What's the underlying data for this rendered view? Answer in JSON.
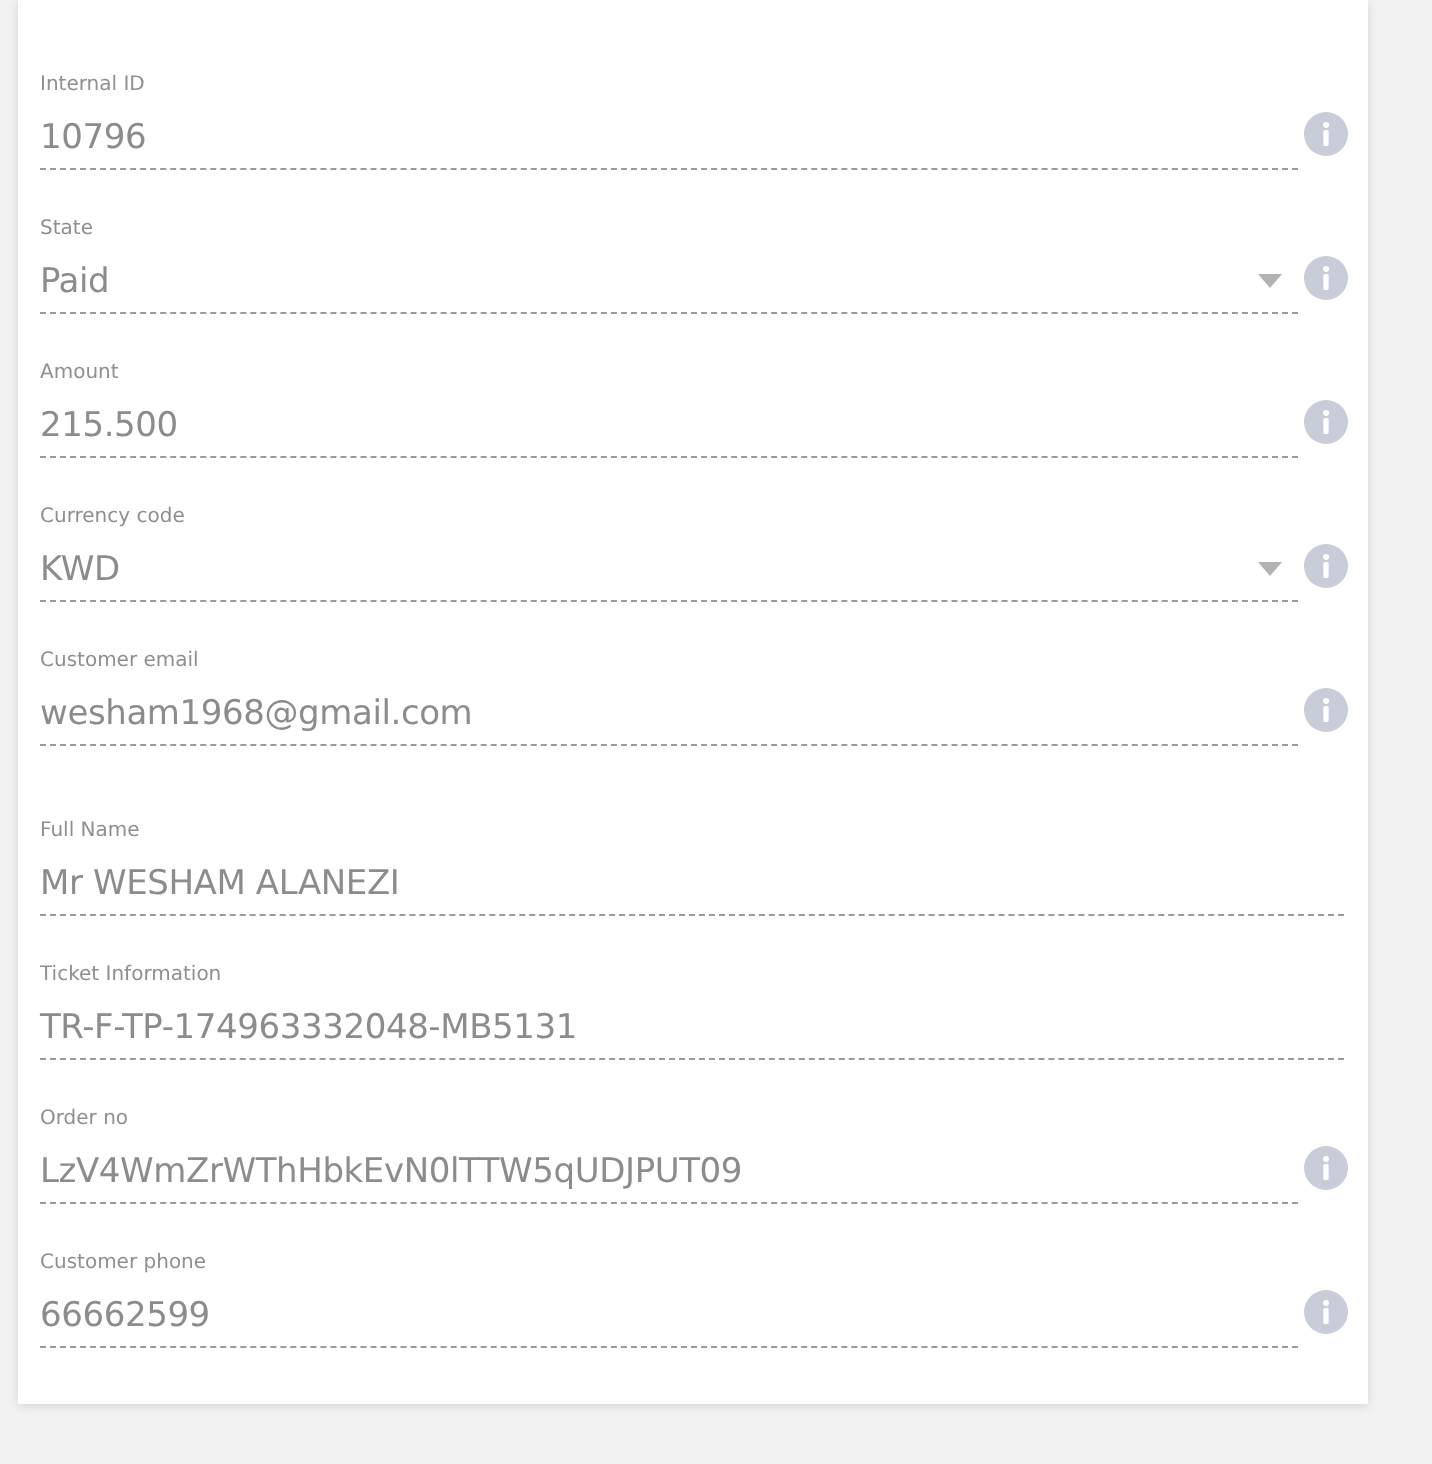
{
  "sections": [
    {
      "fields": [
        {
          "label": "Internal ID",
          "value": "10796",
          "kind": "input",
          "info": true
        },
        {
          "label": "State",
          "value": "Paid",
          "kind": "select",
          "info": true
        },
        {
          "label": "Amount",
          "value": "215.500",
          "kind": "input",
          "info": true
        },
        {
          "label": "Currency code",
          "value": "KWD",
          "kind": "select",
          "info": true
        },
        {
          "label": "Customer email",
          "value": "wesham1968@gmail.com",
          "kind": "input",
          "info": true
        }
      ]
    },
    {
      "fields": [
        {
          "label": "Full Name",
          "value": "Mr WESHAM ALANEZI",
          "kind": "input",
          "info": false
        },
        {
          "label": "Ticket Information",
          "value": "TR-F-TP-174963332048-MB5131",
          "kind": "input",
          "info": false
        },
        {
          "label": "Order no",
          "value": "LzV4WmZrWThHbkEvN0lTTW5qUDJPUT09",
          "kind": "input",
          "info": true
        },
        {
          "label": "Customer phone",
          "value": "66662599",
          "kind": "input",
          "info": true
        }
      ]
    }
  ]
}
